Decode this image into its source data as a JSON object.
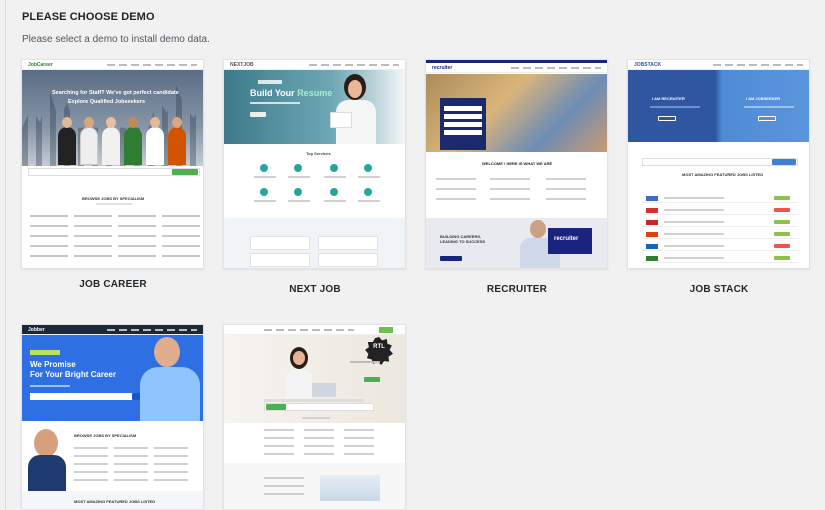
{
  "header": {
    "title": "PLEASE CHOOSE DEMO",
    "subtitle": "Please select a demo to install demo data."
  },
  "demos": [
    {
      "label": "JOB CAREER",
      "preview": {
        "logo": "JobCareer",
        "headline_1": "Searching for Staff? We've got perfect candidate",
        "headline_2": "Explore Qualified Jobseekers",
        "section": "BROWSE JOBS BY SPECIALISM"
      }
    },
    {
      "label": "NEXT JOB",
      "preview": {
        "logo": "NEXTJOB",
        "headline_1": "Build Your",
        "headline_2": "Resume",
        "section": "Top Services"
      }
    },
    {
      "label": "RECRUITER",
      "preview": {
        "logo": "recruiter",
        "section": "WELCOME ! HERE IS WHAT WE ARE",
        "band_text": "BUILDING CAREERS, LEADING TO SUCCESS",
        "band_logo": "recruiter"
      }
    },
    {
      "label": "JOB STACK",
      "preview": {
        "logo": "JOBSTACK",
        "left_title": "I AM RECRUITER",
        "right_title": "I AM JOBSEEKER",
        "section": "MOST AMAZING FEATURED JOBS LISTED"
      }
    },
    {
      "label": "",
      "preview": {
        "logo": "Jobber",
        "headline_1": "We Promise",
        "headline_2": "For Your Bright Career",
        "section": "BROWSE JOBS BY SPECIALISM",
        "footer_section": "MOST AMAZING FEATURED JOBS LISTED"
      }
    },
    {
      "label": "",
      "preview": {
        "badge": "RTL"
      }
    }
  ],
  "colors": {
    "page_bg": "#f1f1f1",
    "card_bg": "#ffffff",
    "recruiter_navy": "#1a237e",
    "jobstack_blue": "#3056a2",
    "jobber_blue": "#2f6fe4",
    "nextjob_teal": "#3c7a8a"
  }
}
